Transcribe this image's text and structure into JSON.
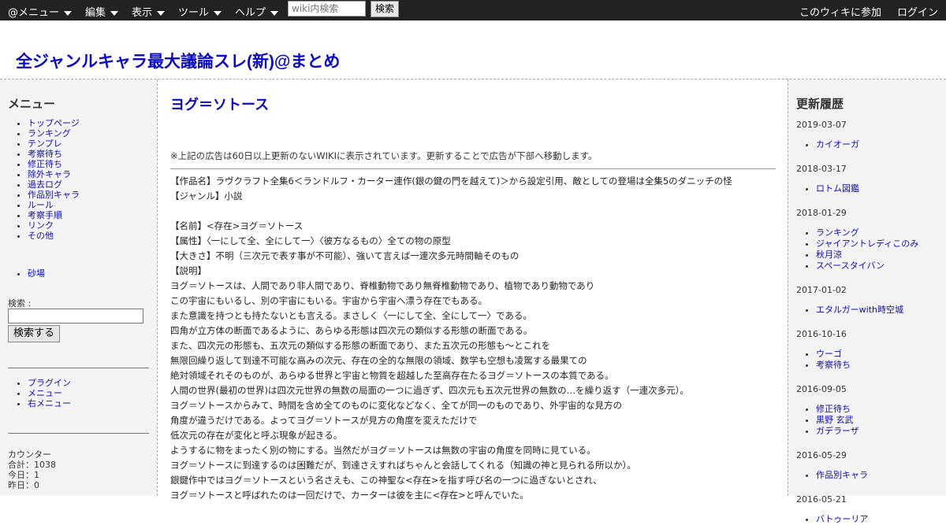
{
  "topbar": {
    "menus": [
      "@メニュー",
      "編集",
      "表示",
      "ツール",
      "ヘルプ"
    ],
    "search_placeholder": "wiki内検索",
    "search_button": "検索",
    "join": "このウィキに参加",
    "login": "ログイン"
  },
  "site": {
    "title": "全ジャンルキャラ最大議論スレ(新)@まとめ"
  },
  "left": {
    "heading": "メニュー",
    "menu_items": [
      "トップページ",
      "ランキング",
      "テンプレ",
      "考察待ち",
      "修正待ち",
      "除外キャラ",
      "過去ログ",
      "作品別キャラ",
      "ルール",
      "考察手順",
      "リンク",
      "その他"
    ],
    "extra_item": "砂場",
    "search_label": "検索 :",
    "search_button": "検索する",
    "plugin_items": [
      "プラグイン",
      "メニュー",
      "右メニュー"
    ],
    "counter_label": "カウンター",
    "counter_total": "合計：1038",
    "counter_today": "今日：1",
    "counter_yesterday": "昨日：0"
  },
  "main": {
    "page_title": "ヨグ＝ソトース",
    "ad_note": "※上記の広告は60日以上更新のないWIKIに表示されています。更新することで広告が下部へ移動します。",
    "lines": [
      "【作品名】ラヴクラフト全集6＜ランドルフ・カーター連作(銀の鍵の門を越えて)＞から設定引用、敵としての登場は全集5のダニッチの怪",
      "【ジャンル】小説",
      "",
      "【名前】<存在>ヨグ＝ソトース",
      "【属性】〈一にして全、全にして一〉〈彼方なるもの〉全ての物の原型",
      "【大きさ】不明（三次元で表す事が不可能）、強いて言えば一連次多元時間軸そのもの",
      "【説明】",
      "ヨグ＝ソトースは、人間であり非人間であり、脊椎動物であり無脊椎動物であり、植物であり動物であり",
      "この宇宙にもいるし、別の宇宙にもいる。宇宙から宇宙へ漂う存在でもある。",
      "また意識を持つとも持たないとも言える。まさしく〈一にして全、全にして一〉である。",
      "四角が立方体の断面であるように、あらゆる形態は四次元の類似する形態の断面である。",
      "また、四次元の形態も、五次元の類似する形態の断面であり、また五次元の形態も～とこれを",
      "無限回繰り返して到達不可能な高みの次元、存在の全的な無限の領域、数学も空想も凌駕する最果ての",
      "絶対領域それそのものが、あらゆる世界と宇宙と物質を超越した至高存在たるヨグ＝ソトースの本質である。",
      "人間の世界(最初の世界)は四次元世界の無数の局面の一つに過ぎず、四次元も五次元世界の無数の…を繰り返す（一連次多元）。",
      "ヨグ＝ソトースからみて、時間を含め全てのものに変化などなく、全てが同一のものであり、外宇宙的な見方の",
      "角度が違うだけである。よってヨグ＝ソトースが見方の角度を変えただけで",
      "低次元の存在が変化と呼ぶ現象が起きる。",
      "ようするに物をまったく別の物にする。当然だがヨグ＝ソトースは無数の宇宙の角度を同時に見ている。",
      "ヨグ＝ソトースに到達するのは困難だが、到達さえすればちゃんと会話してくれる（知識の神と見られる所以か）。",
      "銀鍵作中ではヨグ＝ソトースという名さえも、この神聖な<存在>を指す呼び名の一つに過ぎないとされ、",
      "ヨグ＝ソトースと呼ばれたのは一回だけで、カーターは彼を主に<存在>と呼んでいた。"
    ]
  },
  "right": {
    "heading": "更新履歴",
    "groups": [
      {
        "date": "2019-03-07",
        "items": [
          "カイオーガ"
        ]
      },
      {
        "date": "2018-03-17",
        "items": [
          "ロトム図鑑"
        ]
      },
      {
        "date": "2018-01-29",
        "items": [
          "ランキング",
          "ジャイアントレディこのみ",
          "秋月涼",
          "スペースタイバン"
        ]
      },
      {
        "date": "2017-01-02",
        "items": [
          "エタルガーwith時空城"
        ]
      },
      {
        "date": "2016-10-16",
        "items": [
          "ウーゴ",
          "考察待ち"
        ]
      },
      {
        "date": "2016-09-05",
        "items": [
          "修正待ち",
          "黒野 玄武",
          "ガデラーザ"
        ]
      },
      {
        "date": "2016-05-29",
        "items": [
          "作品別キャラ"
        ]
      },
      {
        "date": "2016-05-21",
        "items": [
          "バトゥーリア"
        ]
      }
    ]
  }
}
